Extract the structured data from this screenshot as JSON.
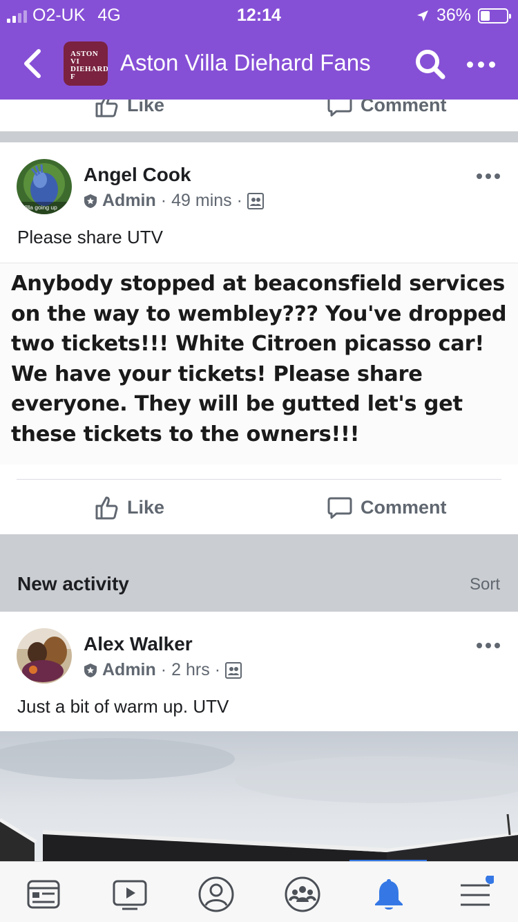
{
  "status_bar": {
    "carrier": "O2-UK",
    "network": "4G",
    "time": "12:14",
    "battery": "36%",
    "battery_level": 0.36,
    "signal_bars": 2
  },
  "header": {
    "group_name": "Aston Villa Diehard Fans",
    "group_thumb_text_1": "ASTON VI",
    "group_thumb_text_2": "DIEHARD F",
    "back_icon": "chevron-left-icon",
    "search_icon": "search-icon",
    "more_icon": "more-horizontal-icon"
  },
  "previous_post": {
    "like_label": "Like",
    "comment_label": "Comment"
  },
  "post1": {
    "author": "Angel Cook",
    "role": "Admin",
    "time": "49 mins",
    "avatar_caption": "Villa going up",
    "text": "Please share UTV",
    "shared_image_text": "Anybody stopped at beaconsfield services on the way to wembley??? You've dropped two tickets!!! White Citroen picasso car! We have your tickets! Please share everyone. They will be gutted let's get these tickets to the owners!!!",
    "like_label": "Like",
    "comment_label": "Comment"
  },
  "new_activity": {
    "label": "New activity",
    "sort_label": "Sort"
  },
  "post2": {
    "author": "Alex Walker",
    "role": "Admin",
    "time": "2 hrs",
    "text": "Just a bit of warm up. UTV"
  },
  "tabbar": {
    "tabs": [
      {
        "icon": "news-feed-icon"
      },
      {
        "icon": "watch-icon"
      },
      {
        "icon": "profile-icon"
      },
      {
        "icon": "groups-icon"
      },
      {
        "icon": "notifications-bell-icon",
        "active": true
      },
      {
        "icon": "menu-icon",
        "badge": true
      }
    ],
    "accent_color": "#3578e5"
  },
  "colors": {
    "header_purple": "#8650d6",
    "separator_gray": "#cacdd1",
    "meta_gray": "#606770"
  }
}
